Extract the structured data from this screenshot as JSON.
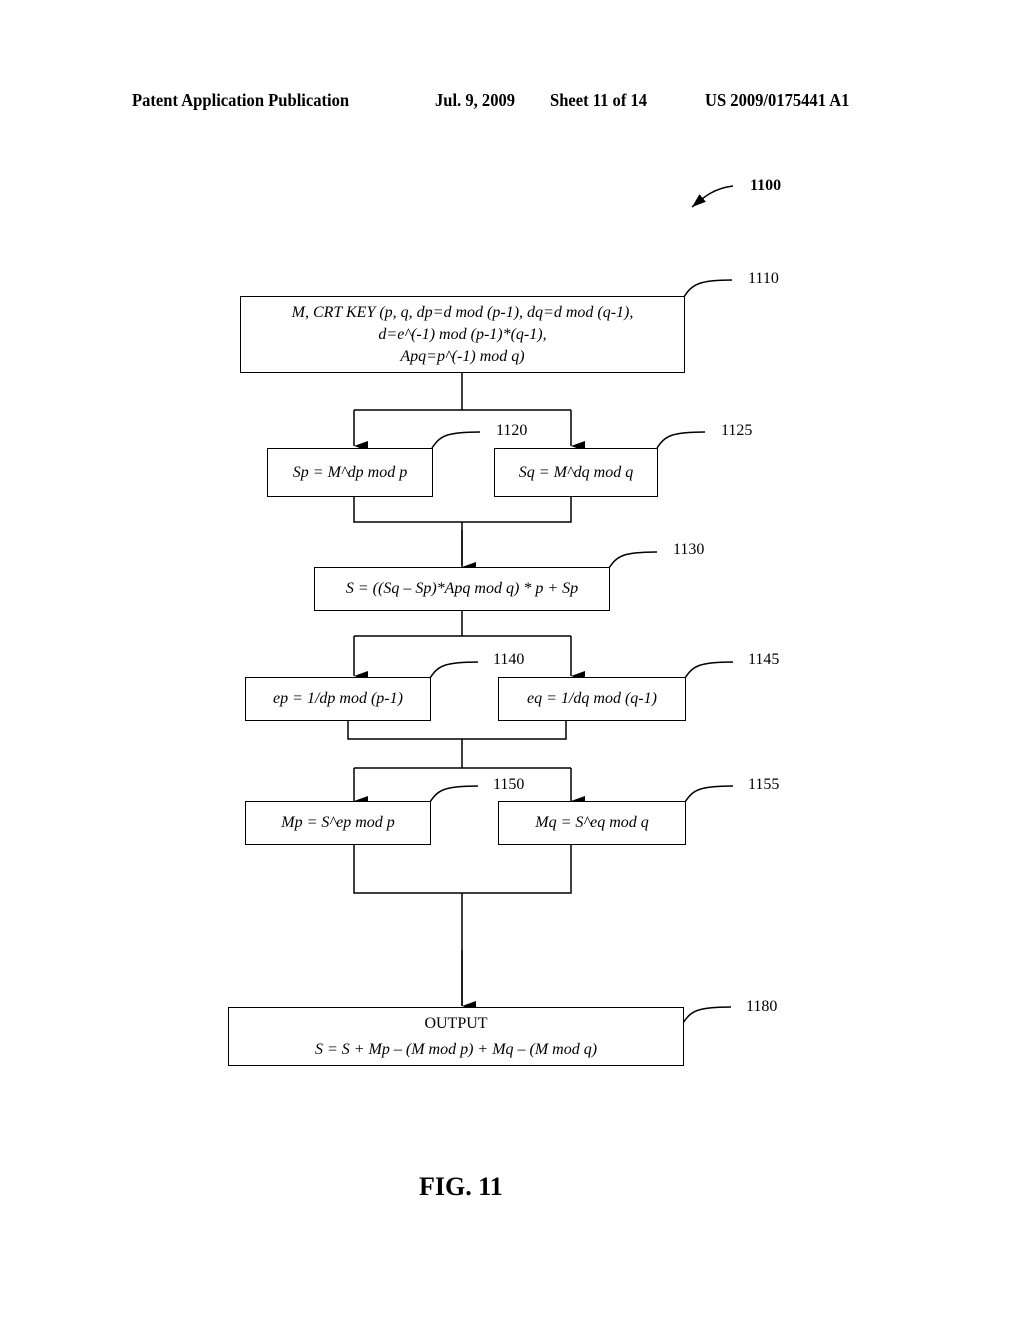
{
  "header": {
    "publication": "Patent Application Publication",
    "date": "Jul. 9, 2009",
    "sheet": "Sheet 11 of 14",
    "number": "US 2009/0175441 A1"
  },
  "diagram": {
    "id": "1100",
    "figure_label": "FIG. 11",
    "steps": [
      {
        "ref": "1110",
        "lines": [
          "M, CRT KEY (p, q, dp=d mod (p-1),  dq=d mod (q-1),",
          "d=e^(-1) mod (p-1)*(q-1),",
          "Apq=p^(-1) mod q)"
        ]
      },
      {
        "ref": "1120",
        "lines": [
          "Sp = M^dp mod p"
        ]
      },
      {
        "ref": "1125",
        "lines": [
          "Sq = M^dq mod q"
        ]
      },
      {
        "ref": "1130",
        "lines": [
          "S = ((Sq – Sp)*Apq mod q) * p + Sp"
        ]
      },
      {
        "ref": "1140",
        "lines": [
          "ep = 1/dp mod (p-1)"
        ]
      },
      {
        "ref": "1145",
        "lines": [
          "eq = 1/dq mod (q-1)"
        ]
      },
      {
        "ref": "1150",
        "lines": [
          "Mp = S^ep mod p"
        ]
      },
      {
        "ref": "1155",
        "lines": [
          "Mq = S^eq mod q"
        ]
      },
      {
        "ref": "1180",
        "lines": [
          "OUTPUT",
          "S = S + Mp – (M mod p) + Mq – (M mod q)"
        ]
      }
    ]
  }
}
